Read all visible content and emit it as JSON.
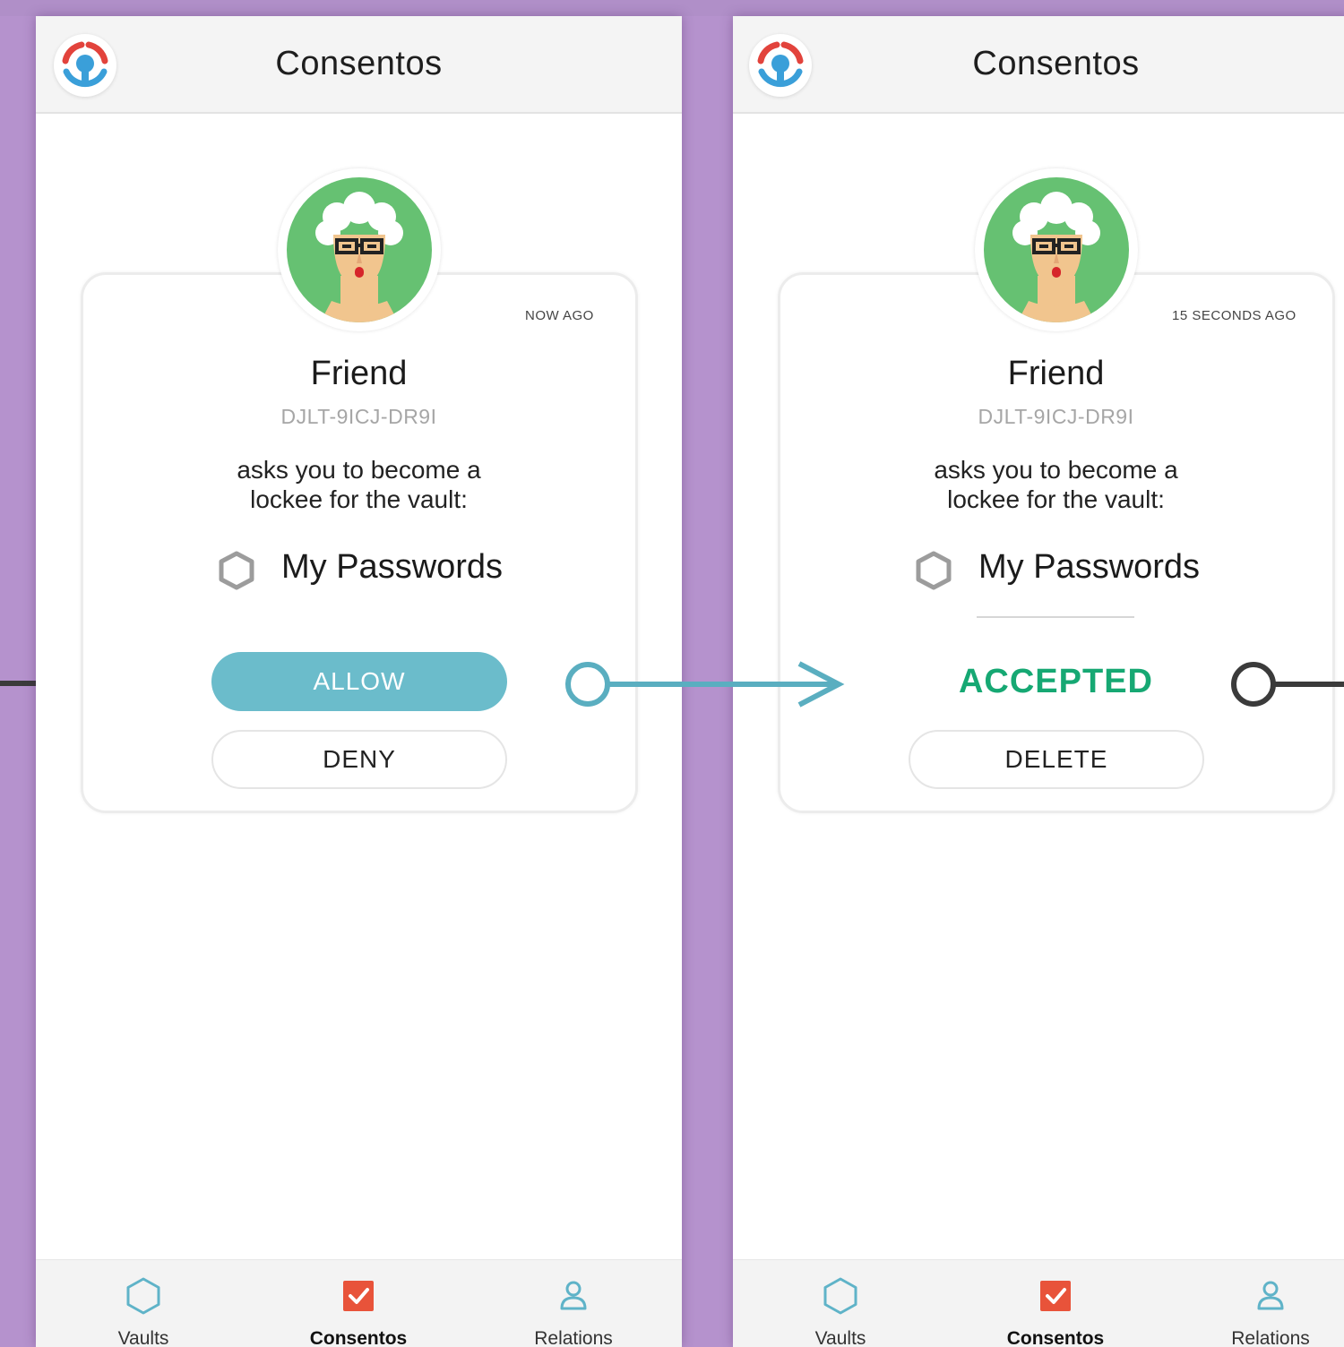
{
  "screens": [
    {
      "header": {
        "title": "Consentos"
      },
      "request": {
        "timestamp": "NOW AGO",
        "friend_name": "Friend",
        "friend_id": "DJLT-9ICJ-DR9I",
        "ask_line1": "asks you to become a",
        "ask_line2": "lockee for the vault:",
        "vault_name": "My Passwords",
        "vault_icon": "hexagon-icon",
        "primary_action": "ALLOW",
        "secondary_action": "DENY"
      },
      "tabs": [
        {
          "label": "Vaults",
          "icon": "hexagon-icon",
          "active": false
        },
        {
          "label": "Consentos",
          "icon": "checkbox-icon",
          "active": true
        },
        {
          "label": "Relations",
          "icon": "person-icon",
          "active": false
        }
      ]
    },
    {
      "header": {
        "title": "Consentos"
      },
      "request": {
        "timestamp": "15 SECONDS AGO",
        "friend_name": "Friend",
        "friend_id": "DJLT-9ICJ-DR9I",
        "ask_line1": "asks you to become a",
        "ask_line2": "lockee for the vault:",
        "vault_name": "My Passwords",
        "vault_icon": "hexagon-icon",
        "status": "ACCEPTED",
        "secondary_action": "DELETE"
      },
      "tabs": [
        {
          "label": "Vaults",
          "icon": "hexagon-icon",
          "active": false
        },
        {
          "label": "Consentos",
          "icon": "checkbox-icon",
          "active": true
        },
        {
          "label": "Relations",
          "icon": "person-icon",
          "active": false
        }
      ]
    }
  ],
  "colors": {
    "background": "#b592cd",
    "allow_button": "#6bbccb",
    "accepted_text": "#16a873",
    "active_tab_icon": "#e8533a",
    "logo_red": "#e2433c",
    "logo_blue": "#3a9fd9",
    "avatar_green": "#66c172",
    "flow_arrow_teal": "#5aaec0",
    "flow_arrow_dark": "#3b3b3b"
  }
}
